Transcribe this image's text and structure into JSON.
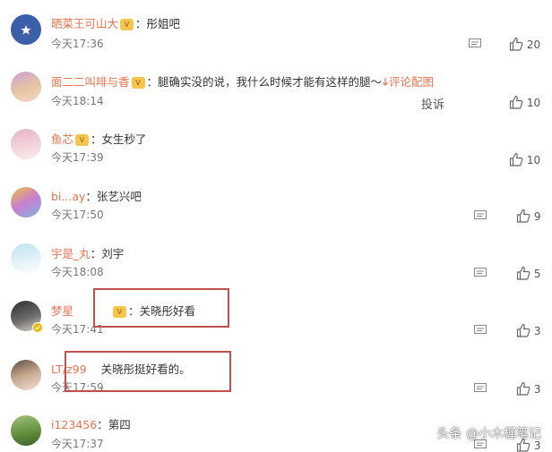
{
  "comments": [
    {
      "user": "晒菜王可山大",
      "text": "彤姐吧",
      "time": "今天17:36",
      "likes": "20"
    },
    {
      "user": "面二二叫啡与香",
      "text": "腿确实没的说，我什么时候才能有这样的腿～",
      "link": "评论配图",
      "time": "今天18:14",
      "report": "投诉",
      "likes": "10"
    },
    {
      "user": "鱼芯",
      "text": "女生秒了",
      "time": "今天17:39",
      "likes": "10"
    },
    {
      "user": "bi...ay",
      "text": "张艺兴吧",
      "time": "今天17:50",
      "likes": "9"
    },
    {
      "user": "宇是_丸",
      "text": "刘宇",
      "time": "今天18:08",
      "likes": "5"
    },
    {
      "user": "梦星",
      "text": "关晓彤好看",
      "time": "今天17:41",
      "likes": "3"
    },
    {
      "user": "LT/z99",
      "text": "关晓彤挺好看的。",
      "time": "今天17:59",
      "likes": "3"
    },
    {
      "user": "ⅰ123456",
      "text": "第四",
      "time": "今天17:37",
      "likes": "3"
    }
  ],
  "colon": "：",
  "watermark": "头条 @小木槿笔记",
  "colors": {
    "username": "#eb7350",
    "highlight_box": "#c05050",
    "time": "#777777"
  }
}
